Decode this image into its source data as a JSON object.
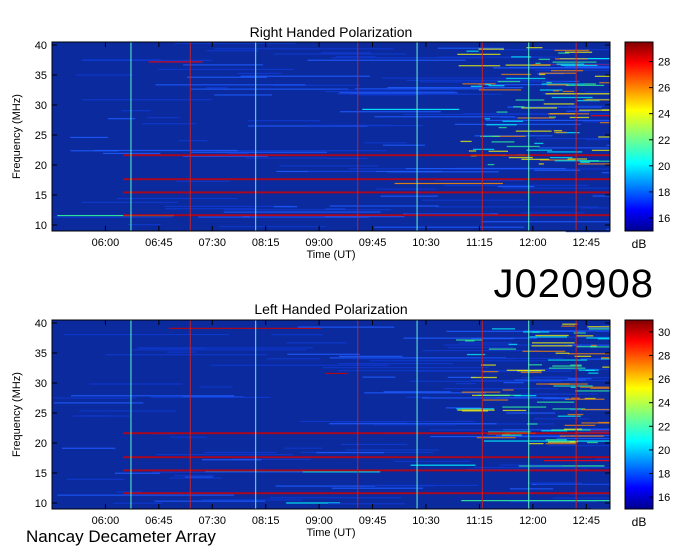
{
  "observation_id": "J020908",
  "footer": "Nancay Decameter Array",
  "chart_data": [
    {
      "type": "heatmap",
      "title": "Right Handed Polarization",
      "xlabel": "Time (UT)",
      "ylabel": "Frequency (MHz)",
      "x_ticks": [
        "06:00",
        "06:45",
        "07:30",
        "08:15",
        "09:00",
        "09:45",
        "10:30",
        "11:15",
        "12:00",
        "12:45"
      ],
      "x_range_min": [
        315,
        785
      ],
      "x_tick_minutes": [
        360,
        405,
        450,
        495,
        540,
        585,
        630,
        675,
        720,
        765
      ],
      "ylim": [
        9,
        40.5
      ],
      "y_ticks": [
        10,
        15,
        20,
        25,
        30,
        35,
        40
      ],
      "colorbar": {
        "label": "dB",
        "ticks": [
          16,
          18,
          20,
          22,
          24,
          26,
          28
        ],
        "range": [
          15,
          29.5
        ]
      },
      "grid": false
    },
    {
      "type": "heatmap",
      "title": "Left Handed Polarization",
      "xlabel": "Time (UT)",
      "ylabel": "Frequency (MHz)",
      "x_ticks": [
        "06:00",
        "06:45",
        "07:30",
        "08:15",
        "09:00",
        "09:45",
        "10:30",
        "11:15",
        "12:00",
        "12:45"
      ],
      "x_range_min": [
        315,
        785
      ],
      "x_tick_minutes": [
        360,
        405,
        450,
        495,
        540,
        585,
        630,
        675,
        720,
        765
      ],
      "ylim": [
        9,
        40.5
      ],
      "y_ticks": [
        10,
        15,
        20,
        25,
        30,
        35,
        40
      ],
      "colorbar": {
        "label": "dB",
        "ticks": [
          16,
          18,
          20,
          22,
          24,
          26,
          28,
          30
        ],
        "range": [
          15,
          31
        ]
      },
      "grid": false
    }
  ]
}
